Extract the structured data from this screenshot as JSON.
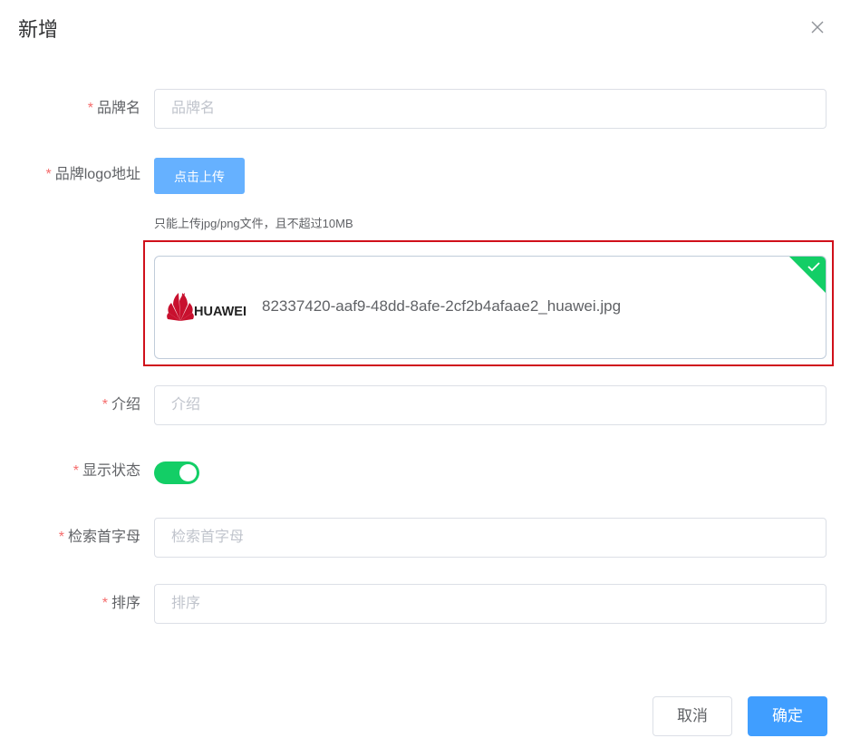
{
  "dialog": {
    "title": "新增",
    "close_icon": "close-icon"
  },
  "form": {
    "brand_name": {
      "label": "品牌名",
      "placeholder": "品牌名",
      "value": "",
      "required": true
    },
    "logo": {
      "label": "品牌logo地址",
      "required": true,
      "upload_button": "点击上传",
      "tip": "只能上传jpg/png文件，且不超过10MB",
      "file": {
        "thumbnail_icon": "huawei-logo",
        "thumbnail_text": "HUAWEI",
        "name": "82337420-aaf9-48dd-8afe-2cf2b4afaae2_huawei.jpg",
        "status_icon": "check-icon",
        "status_color": "#13ce66"
      }
    },
    "description": {
      "label": "介绍",
      "placeholder": "介绍",
      "value": "",
      "required": true
    },
    "show_status": {
      "label": "显示状态",
      "required": true,
      "enabled": true,
      "on_color": "#13ce66"
    },
    "first_letter": {
      "label": "检索首字母",
      "placeholder": "检索首字母",
      "value": "",
      "required": true
    },
    "sort": {
      "label": "排序",
      "placeholder": "排序",
      "value": "",
      "required": true
    }
  },
  "footer": {
    "cancel": "取消",
    "confirm": "确定"
  },
  "colors": {
    "primary": "#409eff",
    "upload_button": "#66b1ff",
    "required_star": "#f56c6c",
    "highlight_border": "#d0101b"
  }
}
